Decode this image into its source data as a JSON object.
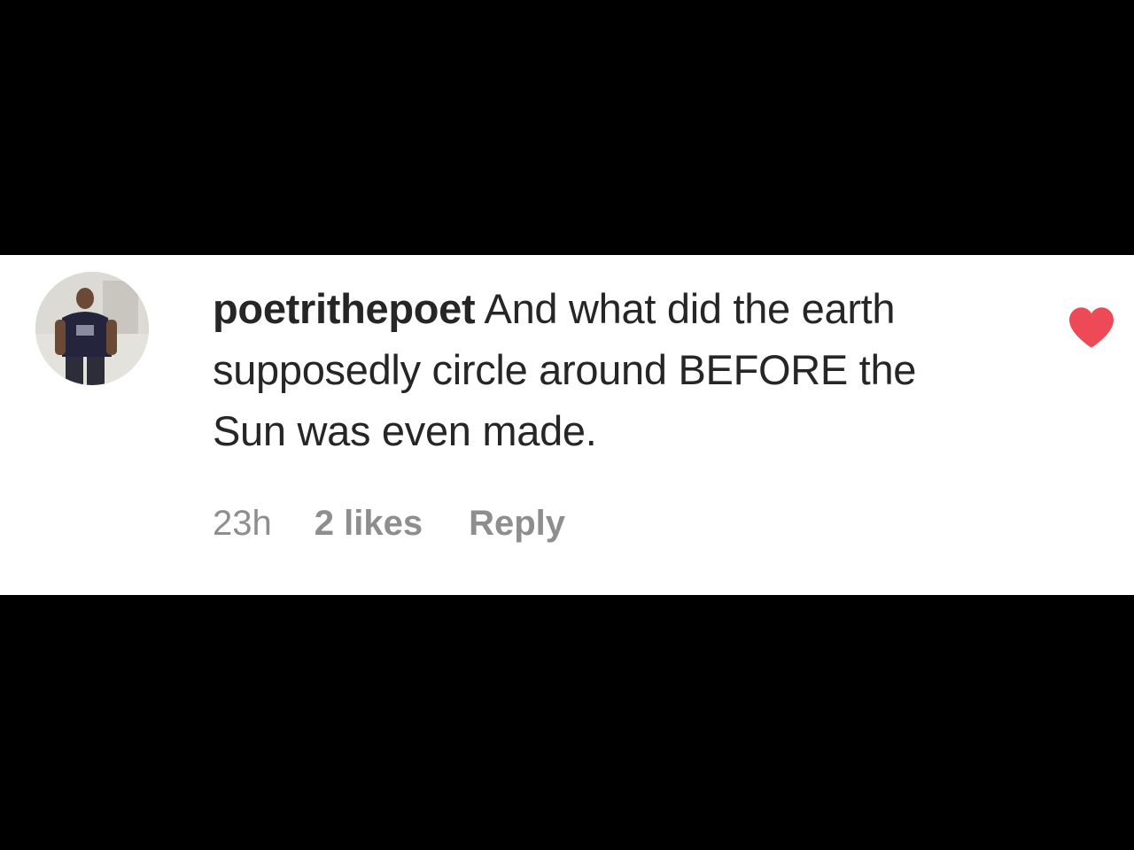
{
  "comment": {
    "username": "poetrithepoet",
    "text": "And what did the earth supposedly circle around BEFORE the Sun was even made.",
    "timestamp": "23h",
    "likes": "2 likes",
    "reply_label": "Reply",
    "liked": true
  },
  "icons": {
    "like": "heart-icon",
    "avatar": "user-avatar"
  },
  "colors": {
    "background": "#000000",
    "card": "#ffffff",
    "text": "#262626",
    "meta": "#8e8e8e",
    "heart": "#ed4956"
  }
}
